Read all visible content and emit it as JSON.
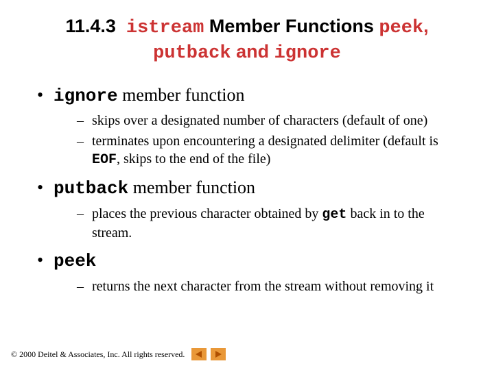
{
  "title": {
    "section_number": "11.4.3",
    "mono1": "istream",
    "plain1": " Member Functions ",
    "mono2": "peek",
    "plain2": ", ",
    "mono3": "putback",
    "plain3": " and ",
    "mono4": "ignore"
  },
  "bullets": [
    {
      "head_mono": "ignore",
      "head_rest": " member function",
      "subs": [
        {
          "pre": "skips over a designated number of characters (default of one)",
          "mono": "",
          "post": ""
        },
        {
          "pre": "terminates upon encountering a designated delimiter (default is ",
          "mono": "EOF",
          "post": ", skips to the end of the file)"
        }
      ]
    },
    {
      "head_mono": "putback",
      "head_rest": " member function",
      "subs": [
        {
          "pre": "places the previous character obtained by ",
          "mono": "get",
          "post": " back in to the stream."
        }
      ]
    },
    {
      "head_mono": "peek",
      "head_rest": "",
      "subs": [
        {
          "pre": "returns the next character from the stream without removing it",
          "mono": "",
          "post": ""
        }
      ]
    }
  ],
  "footer": {
    "copyright": "© 2000 Deitel & Associates, Inc.  All rights reserved."
  },
  "icons": {
    "prev": "prev-arrow-icon",
    "next": "next-arrow-icon"
  },
  "colors": {
    "accent_red": "#cc3333",
    "arrow_bg": "#e99838",
    "arrow_fill": "#b05000"
  }
}
